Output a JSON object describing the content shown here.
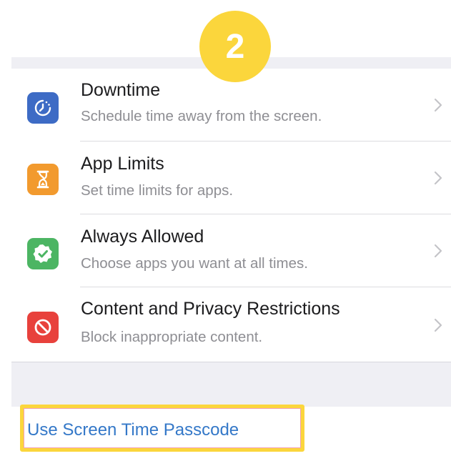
{
  "step_badge": "2",
  "colors": {
    "downtime": "#3d6bc5",
    "app_limits": "#f29a2e",
    "always_allowed": "#4cb563",
    "content_privacy": "#e8413c",
    "link": "#3478c8",
    "highlight": "#fbd63c",
    "group_background": "#efeff4"
  },
  "settings": {
    "items": [
      {
        "title": "Downtime",
        "subtitle": "Schedule time away from the screen.",
        "icon": "downtime-icon"
      },
      {
        "title": "App Limits",
        "subtitle": "Set time limits for apps.",
        "icon": "hourglass-icon"
      },
      {
        "title": "Always Allowed",
        "subtitle": "Choose apps you want at all times.",
        "icon": "checkmark-badge-icon"
      },
      {
        "title": "Content and Privacy Restrictions",
        "subtitle": "Block inappropriate content.",
        "icon": "restriction-icon"
      }
    ]
  },
  "passcode": {
    "label": "Use Screen Time Passcode"
  }
}
